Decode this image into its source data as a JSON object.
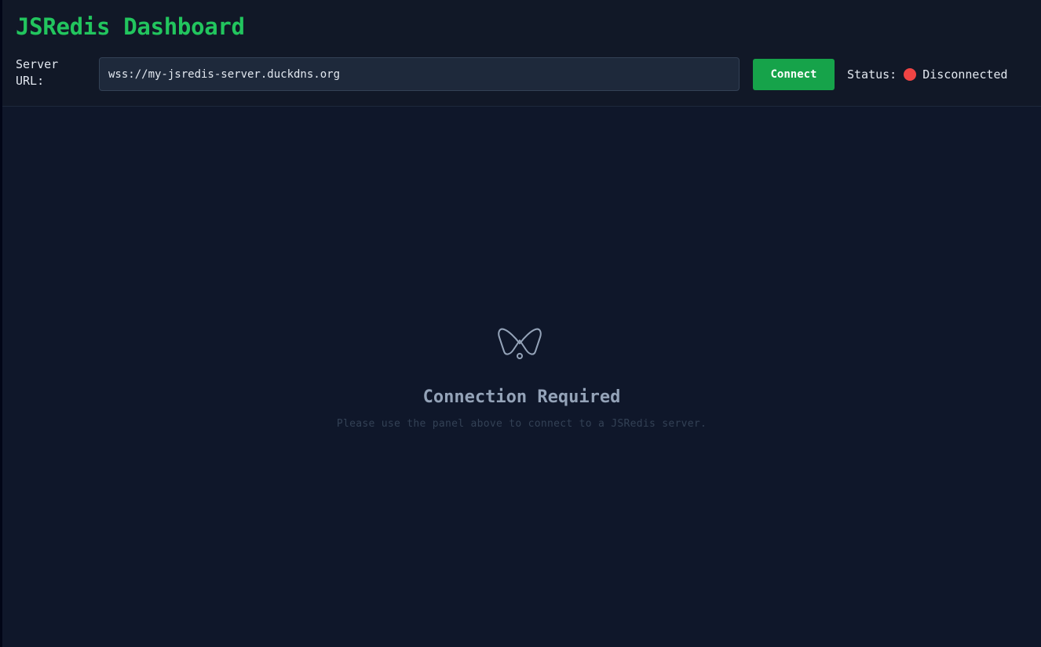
{
  "header": {
    "title": "JSRedis Dashboard",
    "server_label": "Server URL:",
    "server_url_value": "wss://my-jsredis-server.duckdns.org",
    "connect_label": "Connect",
    "status_label": "Status:",
    "status_value": "Disconnected",
    "status_color": "#ef4444"
  },
  "main": {
    "icon": "disconnected-plug-icon",
    "title": "Connection Required",
    "subtitle": "Please use the panel above to connect to a JSRedis server."
  },
  "colors": {
    "accent": "#22c55e",
    "button": "#16a34a",
    "background": "#0f172a",
    "header_background": "#111827"
  }
}
